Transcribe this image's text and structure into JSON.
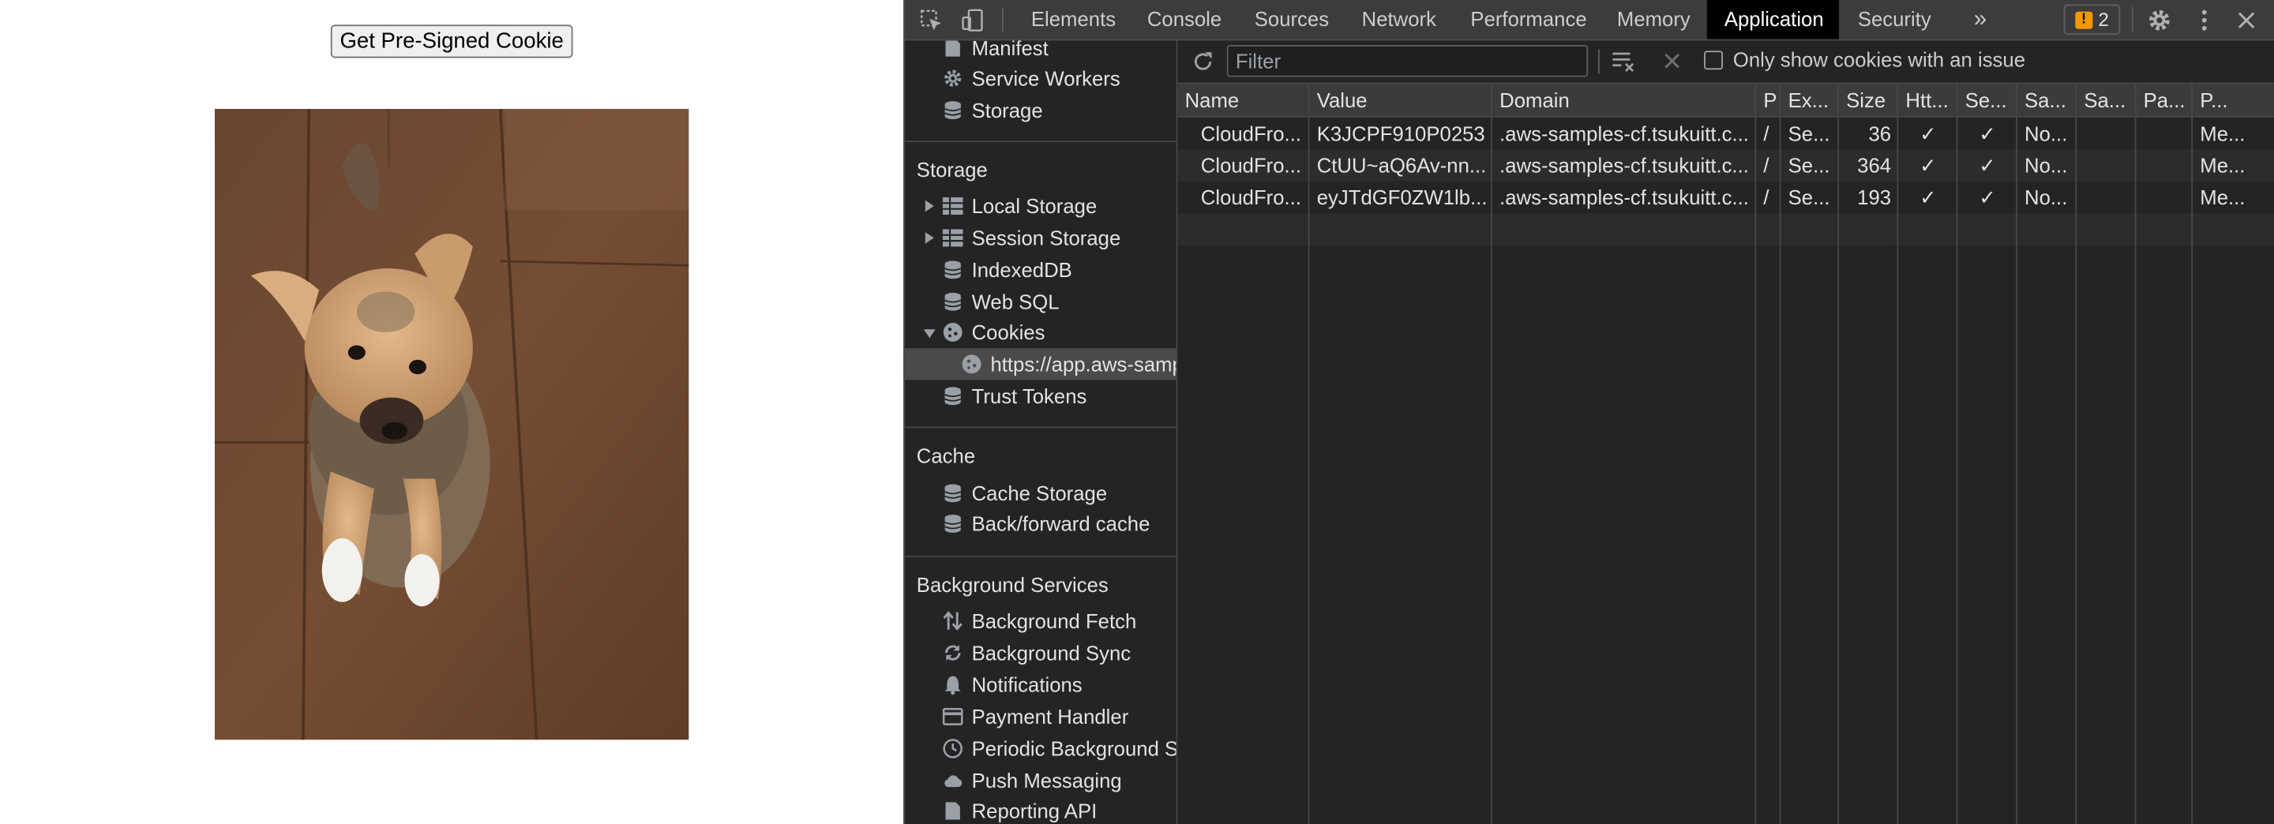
{
  "page": {
    "button_label": "Get Pre-Signed Cookie"
  },
  "devtools": {
    "tabs": [
      "Elements",
      "Console",
      "Sources",
      "Network",
      "Performance",
      "Memory",
      "Application",
      "Security"
    ],
    "active_tab": "Application",
    "more_tabs_glyph": "»",
    "issues_count": "2",
    "sidebar": {
      "app_items": [
        {
          "label": "Manifest",
          "icon": "file-icon"
        },
        {
          "label": "Service Workers",
          "icon": "gear-icon"
        },
        {
          "label": "Storage",
          "icon": "database-icon"
        }
      ],
      "storage_heading": "Storage",
      "storage_items": [
        {
          "label": "Local Storage",
          "icon": "table-icon"
        },
        {
          "label": "Session Storage",
          "icon": "table-icon"
        },
        {
          "label": "IndexedDB",
          "icon": "database-icon"
        },
        {
          "label": "Web SQL",
          "icon": "database-icon"
        },
        {
          "label": "Cookies",
          "icon": "cookie-icon"
        },
        {
          "label": "https://app.aws-samp",
          "icon": "cookie-icon"
        },
        {
          "label": "Trust Tokens",
          "icon": "database-icon"
        }
      ],
      "cache_heading": "Cache",
      "cache_items": [
        {
          "label": "Cache Storage",
          "icon": "database-icon"
        },
        {
          "label": "Back/forward cache",
          "icon": "database-icon"
        }
      ],
      "bg_heading": "Background Services",
      "bg_items": [
        {
          "label": "Background Fetch",
          "icon": "arrows-icon"
        },
        {
          "label": "Background Sync",
          "icon": "sync-icon"
        },
        {
          "label": "Notifications",
          "icon": "bell-icon"
        },
        {
          "label": "Payment Handler",
          "icon": "card-icon"
        },
        {
          "label": "Periodic Background Sy",
          "icon": "clock-icon"
        },
        {
          "label": "Push Messaging",
          "icon": "cloud-icon"
        },
        {
          "label": "Reporting API",
          "icon": "file-icon"
        }
      ]
    },
    "filter_placeholder": "Filter",
    "only_issues_label": "Only show cookies with an issue",
    "columns": [
      "Name",
      "Value",
      "Domain",
      "P",
      "Ex...",
      "Size",
      "Htt...",
      "Se...",
      "Sa...",
      "Sa...",
      "Pa...",
      "P..."
    ],
    "rows": [
      [
        "CloudFro...",
        "K3JCPF910P0253",
        ".aws-samples-cf.tsukuitt.c...",
        "/",
        "Se...",
        "36",
        "✓",
        "✓",
        "No...",
        "",
        "",
        "Me..."
      ],
      [
        "CloudFro...",
        "CtUU~aQ6Av-nn...",
        ".aws-samples-cf.tsukuitt.c...",
        "/",
        "Se...",
        "364",
        "✓",
        "✓",
        "No...",
        "",
        "",
        "Me..."
      ],
      [
        "CloudFro...",
        "eyJTdGF0ZW1lb...",
        ".aws-samples-cf.tsukuitt.c...",
        "/",
        "Se...",
        "193",
        "✓",
        "✓",
        "No...",
        "",
        "",
        "Me..."
      ]
    ],
    "colors": {
      "panel_bg": "#242424",
      "toolbar_bg": "#3c3c3c",
      "active_tab_bg": "#000000",
      "issues_flag": "#f29900"
    }
  }
}
